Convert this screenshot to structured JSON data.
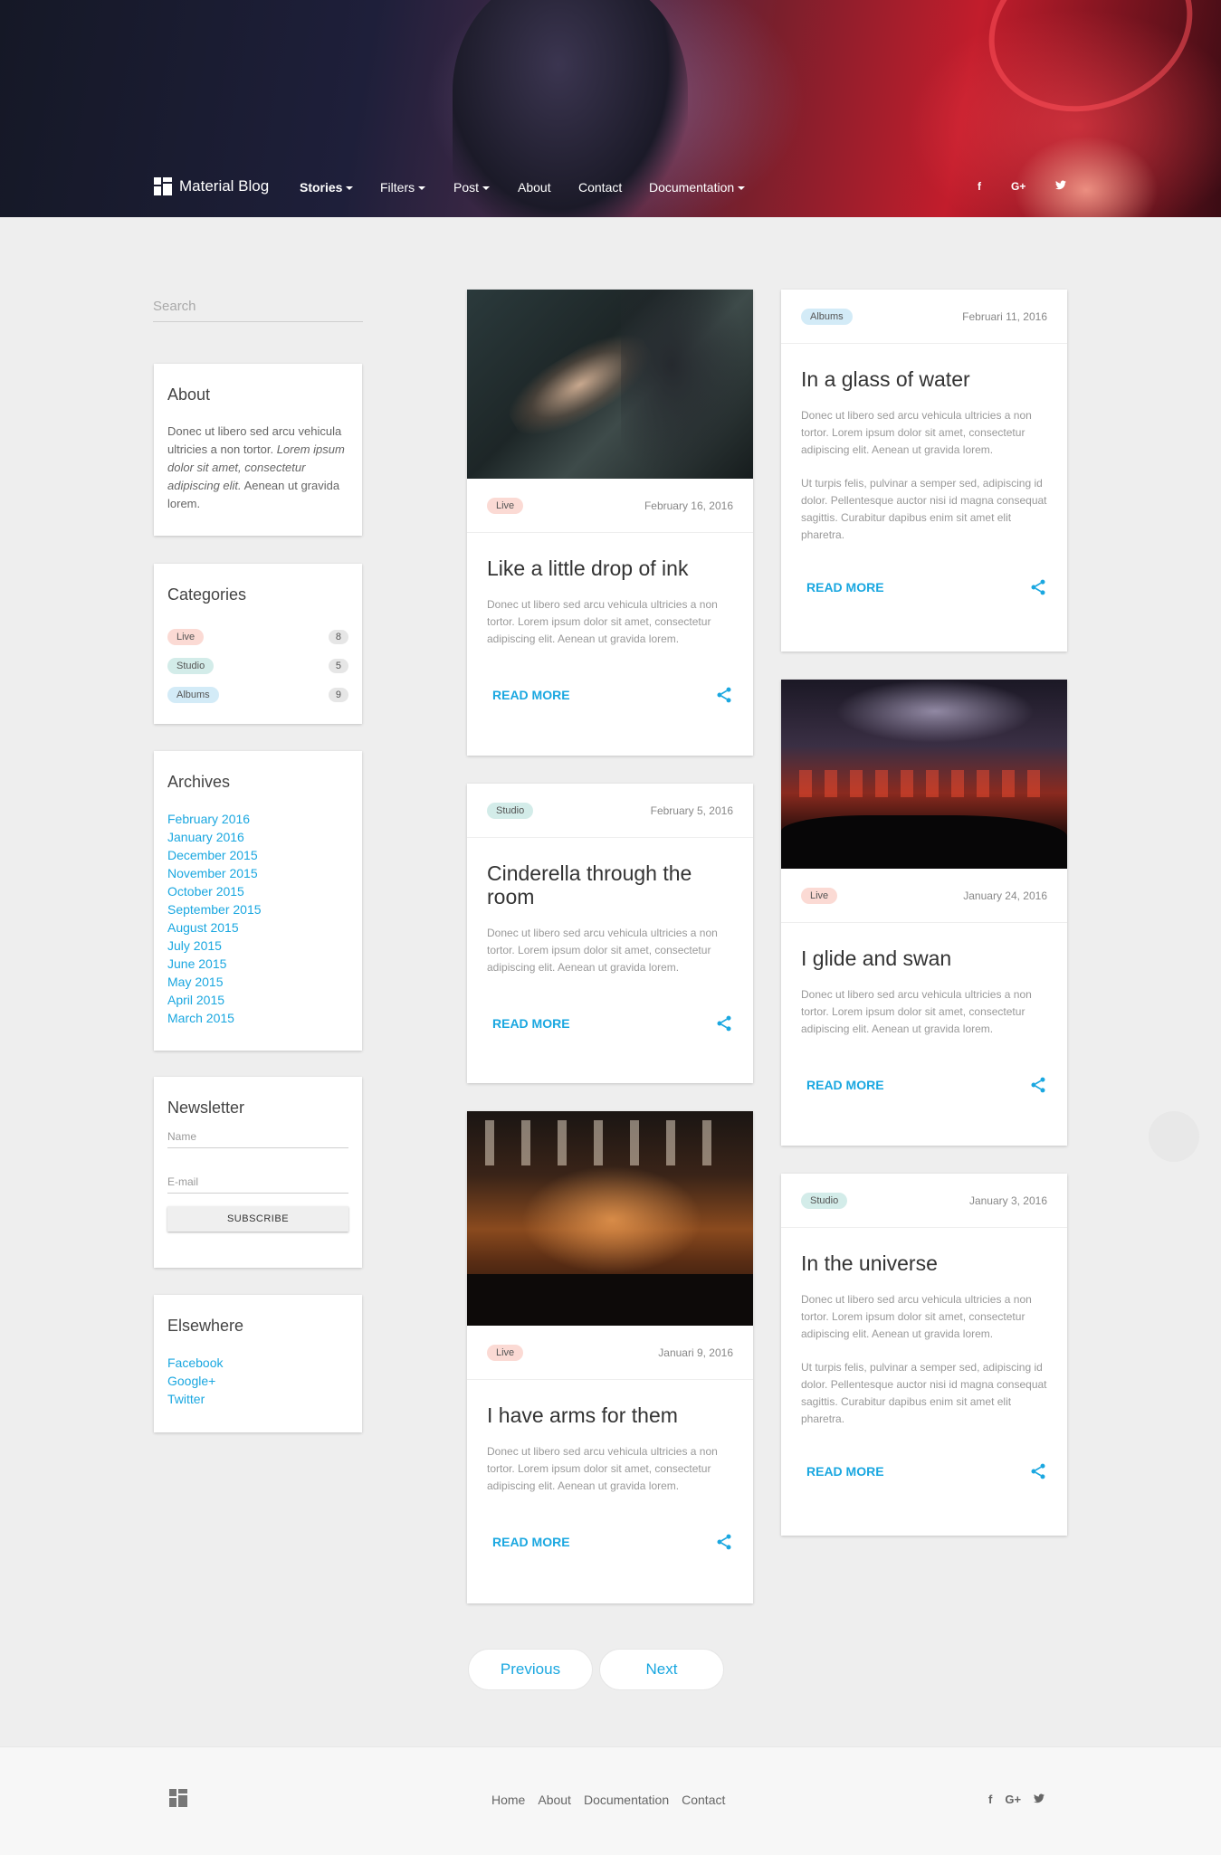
{
  "nav": {
    "brand": "Material Blog",
    "items": [
      {
        "label": "Stories",
        "dropdown": true
      },
      {
        "label": "Filters",
        "dropdown": true
      },
      {
        "label": "Post",
        "dropdown": true
      },
      {
        "label": "About",
        "dropdown": false
      },
      {
        "label": "Contact",
        "dropdown": false
      },
      {
        "label": "Documentation",
        "dropdown": true
      }
    ],
    "social": [
      "f",
      "G+",
      "t"
    ]
  },
  "search": {
    "placeholder": "Search"
  },
  "sidebar": {
    "about": {
      "title": "About",
      "text1": "Donec ut libero sed arcu vehicula ultricies a non tortor.",
      "text_italic": "Lorem ipsum dolor sit amet, consectetur adipiscing elit.",
      "text2": "Aenean ut gravida lorem."
    },
    "categories": {
      "title": "Categories",
      "items": [
        {
          "label": "Live",
          "count": "8"
        },
        {
          "label": "Studio",
          "count": "5"
        },
        {
          "label": "Albums",
          "count": "9"
        }
      ]
    },
    "archives": {
      "title": "Archives",
      "items": [
        "February 2016",
        "January 2016",
        "December 2015",
        "November 2015",
        "October 2015",
        "September 2015",
        "August 2015",
        "July 2015",
        "June 2015",
        "May 2015",
        "April 2015",
        "March 2015"
      ]
    },
    "newsletter": {
      "title": "Newsletter",
      "name_placeholder": "Name",
      "email_placeholder": "E-mail",
      "button": "SUBSCRIBE"
    },
    "elsewhere": {
      "title": "Elsewhere",
      "items": [
        "Facebook",
        "Google+",
        "Twitter"
      ]
    }
  },
  "posts": [
    {
      "tag": "Live",
      "date": "February 16, 2016",
      "title": "Like a little drop of ink",
      "excerpt": "Donec ut libero sed arcu vehicula ultricies a non tortor. Lorem ipsum dolor sit amet, consectetur adipiscing elit. Aenean ut gravida lorem.",
      "read_more": "READ MORE"
    },
    {
      "tag": "Studio",
      "date": "February 5, 2016",
      "title": "Cinderella through the room",
      "excerpt": "Donec ut libero sed arcu vehicula ultricies a non tortor. Lorem ipsum dolor sit amet, consectetur adipiscing elit. Aenean ut gravida lorem.",
      "read_more": "READ MORE"
    },
    {
      "tag": "Live",
      "date": "Januari 9, 2016",
      "title": "I have arms for them",
      "excerpt": "Donec ut libero sed arcu vehicula ultricies a non tortor. Lorem ipsum dolor sit amet, consectetur adipiscing elit. Aenean ut gravida lorem.",
      "read_more": "READ MORE"
    },
    {
      "tag": "Albums",
      "date": "Februari 11, 2016",
      "title": "In a glass of water",
      "excerpt": "Donec ut libero sed arcu vehicula ultricies a non tortor. Lorem ipsum dolor sit amet, consectetur adipiscing elit. Aenean ut gravida lorem.",
      "excerpt2": "Ut turpis felis, pulvinar a semper sed, adipiscing id dolor. Pellentesque auctor nisi id magna consequat sagittis. Curabitur dapibus enim sit amet elit pharetra.",
      "read_more": "READ MORE"
    },
    {
      "tag": "Live",
      "date": "January 24, 2016",
      "title": "I glide and swan",
      "excerpt": "Donec ut libero sed arcu vehicula ultricies a non tortor. Lorem ipsum dolor sit amet, consectetur adipiscing elit. Aenean ut gravida lorem.",
      "read_more": "READ MORE"
    },
    {
      "tag": "Studio",
      "date": "January 3, 2016",
      "title": "In the universe",
      "excerpt": "Donec ut libero sed arcu vehicula ultricies a non tortor. Lorem ipsum dolor sit amet, consectetur adipiscing elit. Aenean ut gravida lorem.",
      "excerpt2": "Ut turpis felis, pulvinar a semper sed, adipiscing id dolor. Pellentesque auctor nisi id magna consequat sagittis. Curabitur dapibus enim sit amet elit pharetra.",
      "read_more": "READ MORE"
    }
  ],
  "pagination": {
    "previous": "Previous",
    "next": "Next"
  },
  "footer": {
    "links": [
      "Home",
      "About",
      "Documentation",
      "Contact"
    ],
    "social": [
      "f",
      "G+",
      "t"
    ]
  },
  "colors": {
    "accent": "#1aa7e0",
    "live": "#fbdad4",
    "studio": "#d3ece9",
    "albums": "#d3ebf7"
  }
}
